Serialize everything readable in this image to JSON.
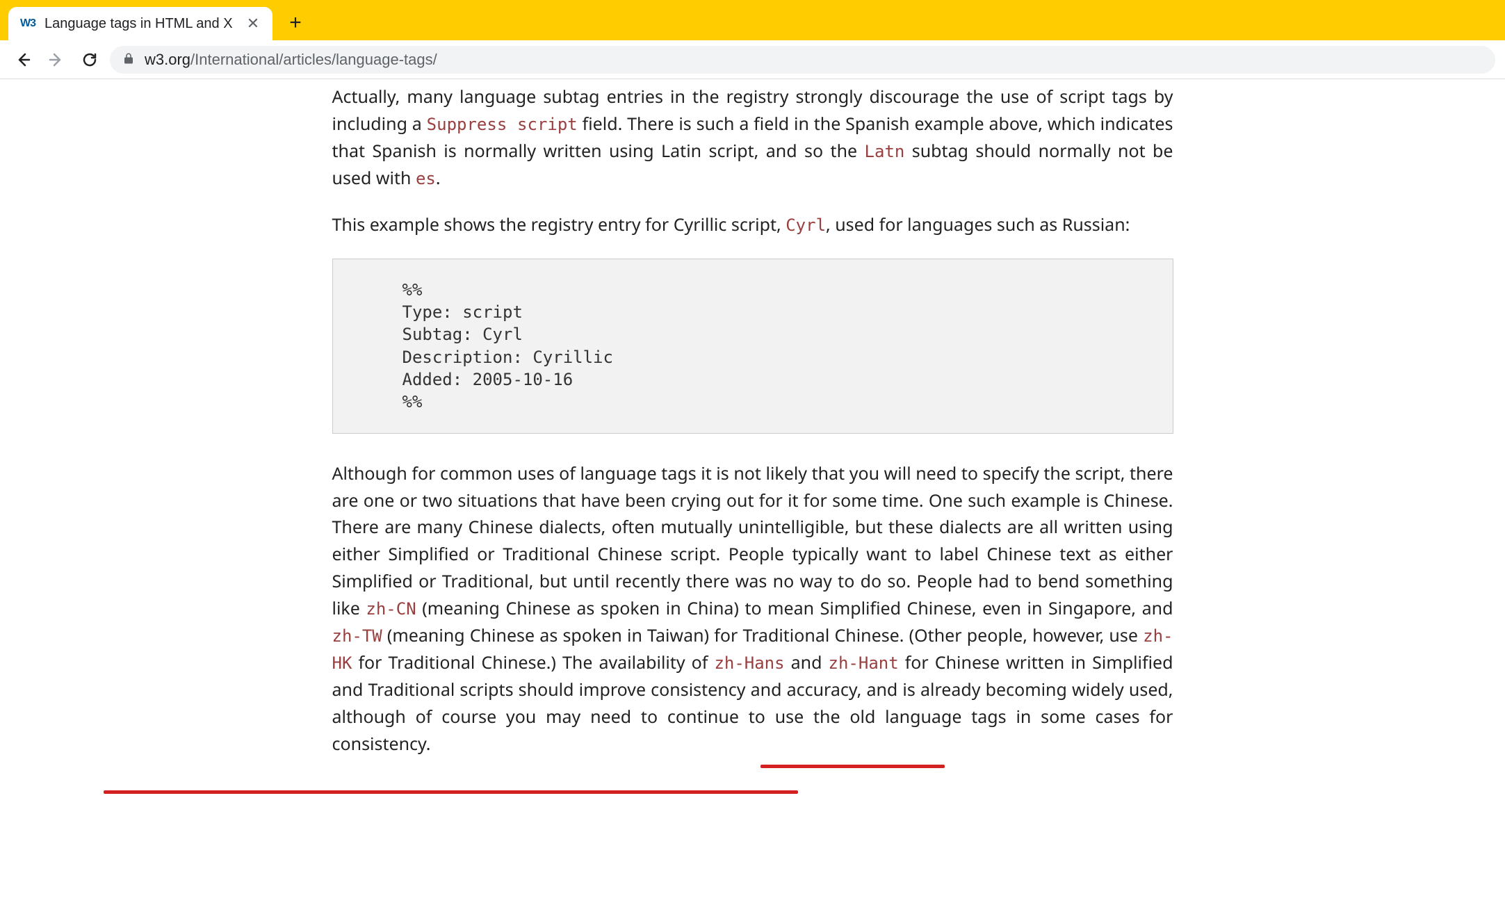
{
  "browser": {
    "tab_title": "Language tags in HTML and X",
    "favicon_text": "W3",
    "url_full": "w3.org/International/articles/language-tags/",
    "url_host": "w3.org",
    "url_path": "/International/articles/language-tags/"
  },
  "content": {
    "p1_a": "Actually, many language subtag entries in the registry strongly discourage the use of script tags by including a ",
    "code_suppress": "Suppress script",
    "p1_b": " field. There is such a field in the Spanish example above, which indicates that Spanish is normally written using Latin script, and so the ",
    "code_latn": "Latn",
    "p1_c": " subtag should normally not be used with ",
    "code_es": "es",
    "p1_d": ".",
    "p2_a": "This example shows the registry entry for Cyrillic script, ",
    "code_cyrl": "Cyrl",
    "p2_b": ", used for languages such as Russian:",
    "registry_block": "%%\nType: script\nSubtag: Cyrl\nDescription: Cyrillic\nAdded: 2005-10-16\n%%",
    "p3_a": "Although for common uses of language tags it is not likely that you will need to specify the script, there are one or two situations that have been crying out for it for some time. One such example is Chinese. There are many Chinese dialects, often mutually unintelligible, but these dialects are all written using either Simplified or Traditional Chinese script. People typically want to label Chinese text as either Simplified or Traditional, but until recently there was no way to do so. People had to bend something like ",
    "code_zhcn": "zh-CN",
    "p3_b": " (meaning Chinese as spoken in China) to mean Simplified Chinese, even in Singapore, and ",
    "code_zhtw": "zh-TW",
    "p3_c": " (meaning Chinese as spoken in Taiwan) for Traditional Chinese. (Other people, however, use ",
    "code_zhhk": "zh-HK",
    "p3_d": " for Traditional Chinese.) The availability of ",
    "code_zhhans": "zh-Hans",
    "p3_e": " and ",
    "code_zhhant": "zh-Hant",
    "p3_f": " for Chinese written in Simplified and Traditional scripts should improve consistency and accuracy, and is already becoming widely used, although of course you may need to continue to use the old language tags in some cases for consistency."
  }
}
